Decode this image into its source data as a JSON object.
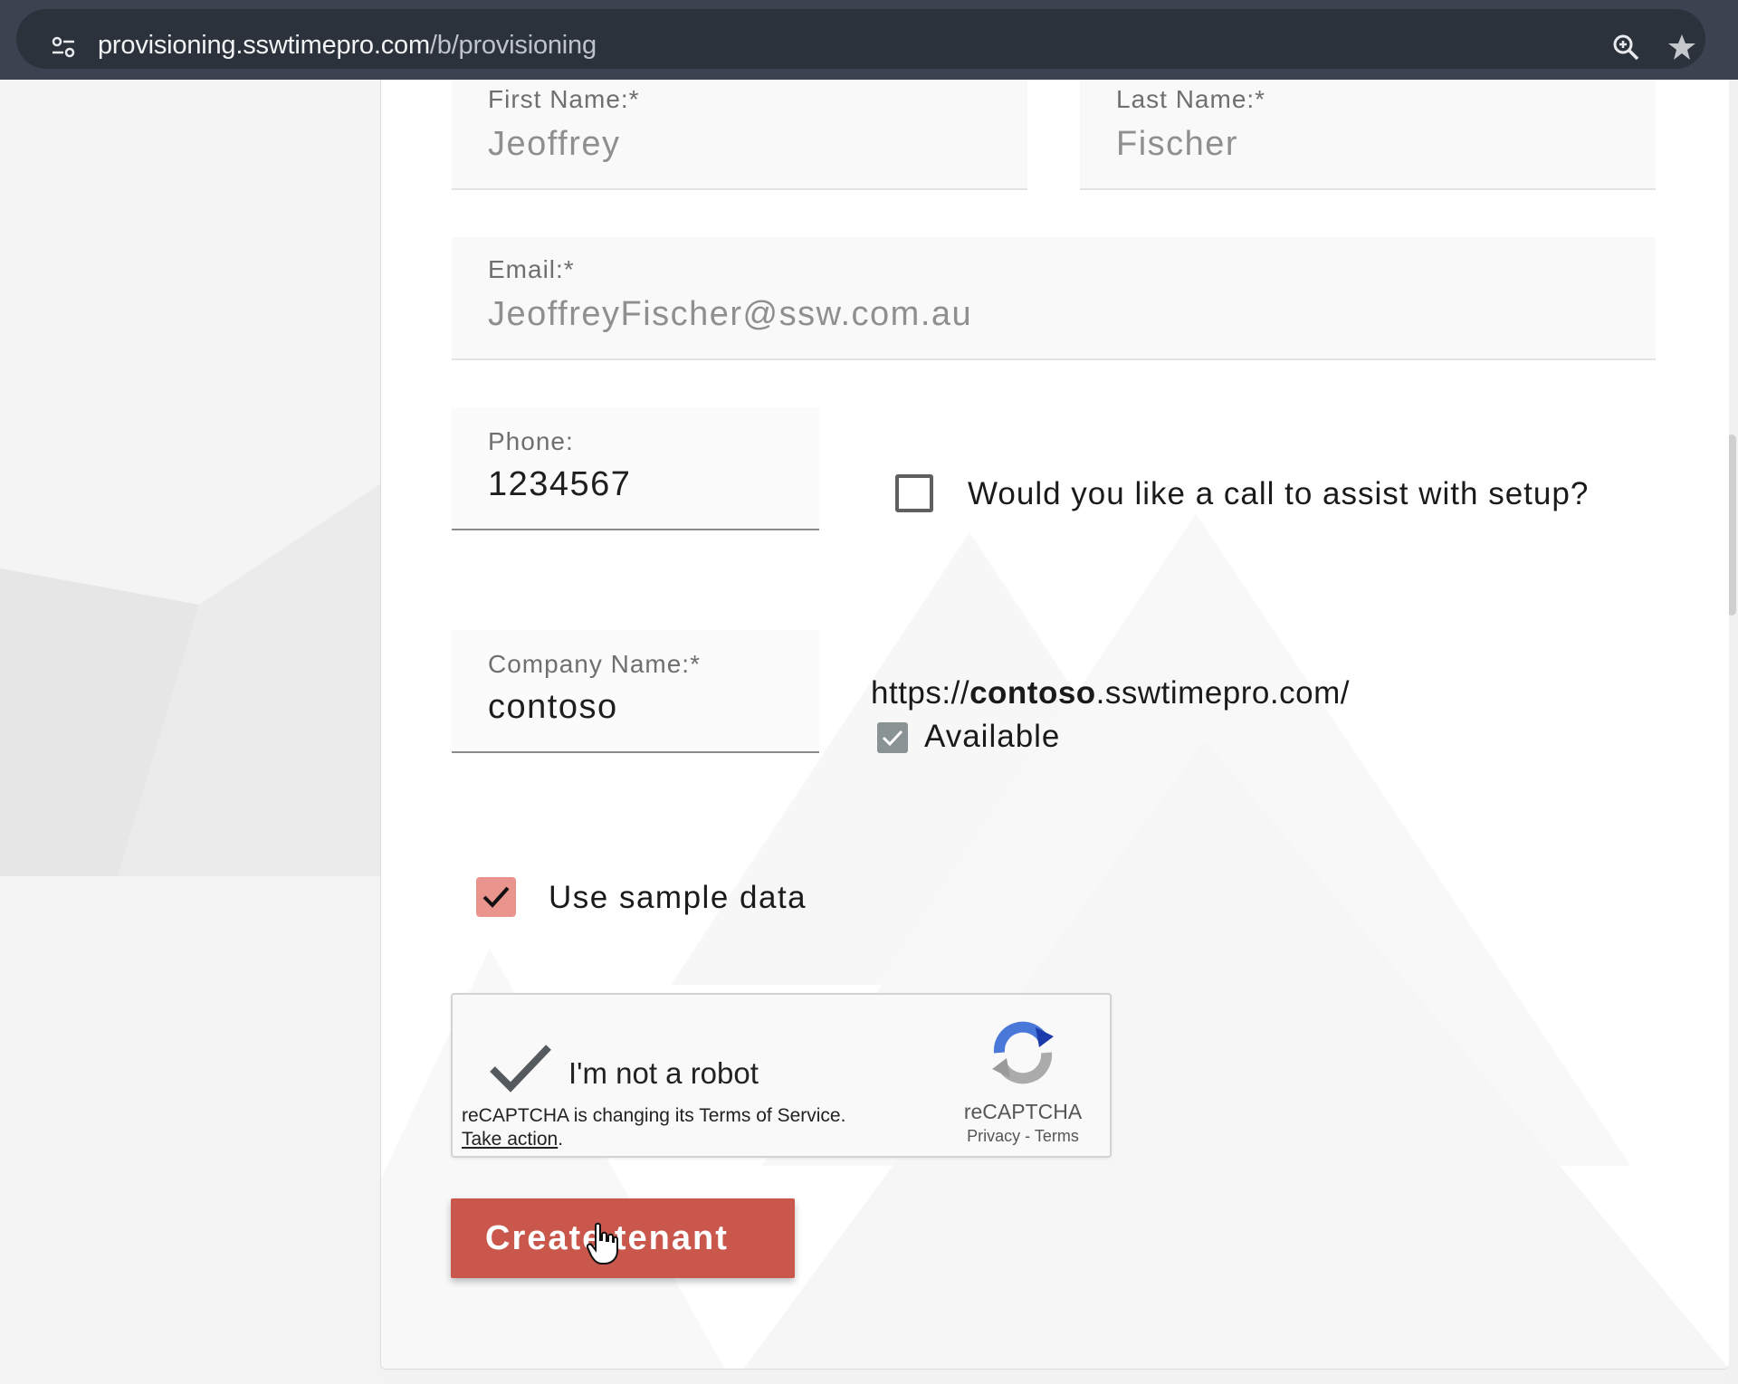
{
  "browser": {
    "url_host": "provisioning.sswtimepro.com",
    "url_path": "/b/provisioning",
    "icons": [
      "site-settings-icon",
      "zoom-icon",
      "bookmark-star-icon"
    ]
  },
  "form": {
    "first_name": {
      "label": "First Name:*",
      "value": "Jeoffrey"
    },
    "last_name": {
      "label": "Last Name:*",
      "value": "Fischer"
    },
    "email": {
      "label": "Email:*",
      "value": "JeoffreyFischer@ssw.com.au"
    },
    "phone": {
      "label": "Phone:",
      "value": "1234567"
    },
    "call_assist": {
      "label": "Would you like a call to assist with setup?",
      "checked": false
    },
    "company": {
      "label": "Company Name:*",
      "value": "contoso"
    },
    "tenant_url": {
      "prefix": "https://",
      "subdomain": "contoso",
      "suffix": ".sswtimepro.com/"
    },
    "availability": {
      "label": "Available",
      "checked": true
    },
    "sample_data": {
      "label": "Use sample data",
      "checked": true
    },
    "recaptcha": {
      "title": "I'm not a robot",
      "note": "reCAPTCHA is changing its Terms of Service.",
      "action": "Take action",
      "action_suffix": ".",
      "brand": "reCAPTCHA",
      "privacy": "Privacy",
      "separator": " - ",
      "terms": "Terms"
    },
    "submit_label": "Create tenant"
  },
  "colors": {
    "accent": "#c9574c",
    "sample_check": "#e9948c",
    "available_check": "#8a9393"
  }
}
